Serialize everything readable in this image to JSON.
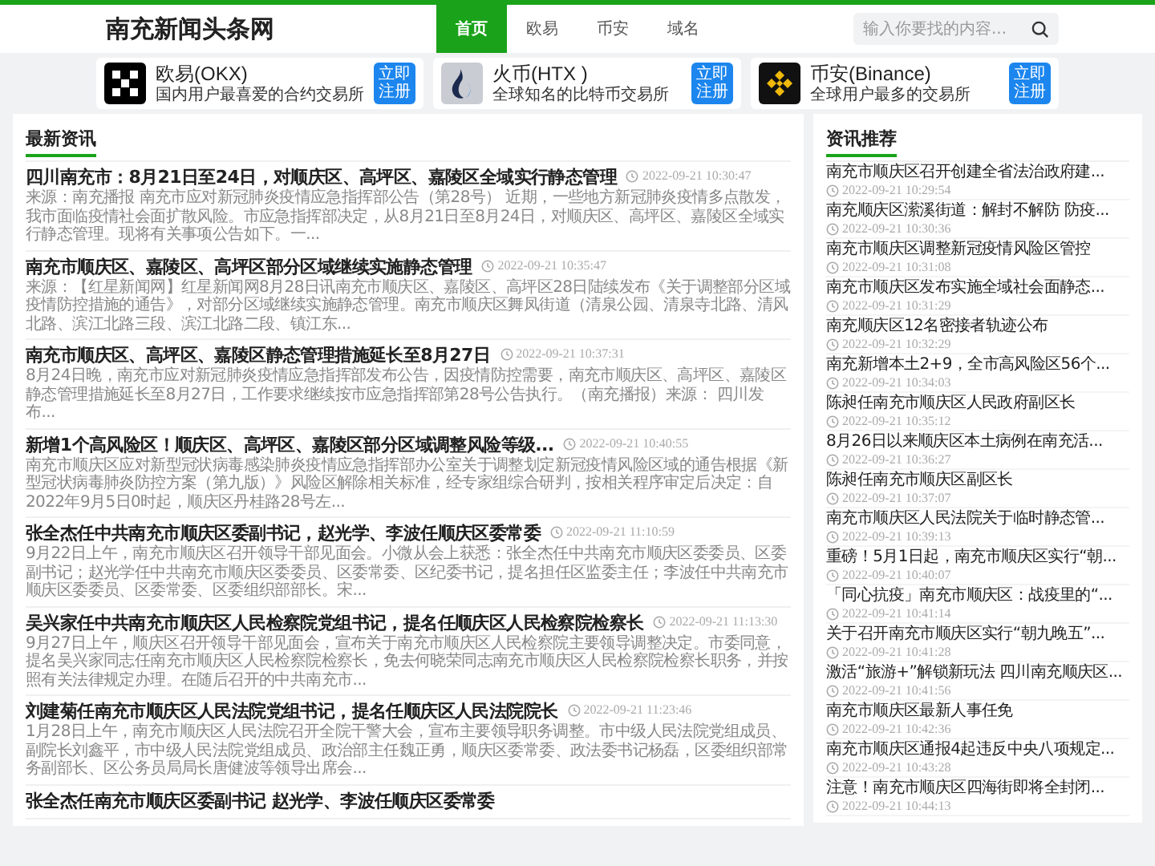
{
  "header": {
    "logo": "南充新闻头条网",
    "nav": [
      {
        "label": "首页",
        "selected": true
      },
      {
        "label": "欧易",
        "selected": false
      },
      {
        "label": "币安",
        "selected": false
      },
      {
        "label": "域名",
        "selected": false
      }
    ],
    "search": {
      "placeholder": "输入你要找的内容..."
    }
  },
  "ads": [
    {
      "title": "欧易(OKX)",
      "subtitle": "国内用户最喜爱的合约交易所",
      "button": "立即注册"
    },
    {
      "title": "火币(HTX )",
      "subtitle": "全球知名的比特币交易所",
      "button": "立即注册"
    },
    {
      "title": "币安(Binance)",
      "subtitle": "全球用户最多的交易所",
      "button": "立即注册"
    }
  ],
  "latest": {
    "heading": "最新资讯",
    "articles": [
      {
        "title": "四川南充市：8月21日至24日，对顺庆区、高坪区、嘉陵区全域实行静态管理",
        "time": "2022-09-21 10:30:47",
        "summary": "来源：南充播报 南充市应对新冠肺炎疫情应急指挥部公告（第28号） 近期，一些地方新冠肺炎疫情多点散发，我市面临疫情社会面扩散风险。市应急指挥部决定，从8月21日至8月24日，对顺庆区、高坪区、嘉陵区全域实行静态管理。现将有关事项公告如下。一..."
      },
      {
        "title": "南充市顺庆区、嘉陵区、高坪区部分区域继续实施静态管理",
        "time": "2022-09-21 10:35:47",
        "summary": "来源：【红星新闻网】红星新闻网8月28日讯南充市顺庆区、嘉陵区、高坪区28日陆续发布《关于调整部分区域疫情防控措施的通告》，对部分区域继续实施静态管理。南充市顺庆区舞凤街道（清泉公园、清泉寺北路、清风北路、滨江北路三段、滨江北路二段、镇江东..."
      },
      {
        "title": "南充市顺庆区、高坪区、嘉陵区静态管理措施延长至8月27日",
        "time": "2022-09-21 10:37:31",
        "summary": "8月24日晚，南充市应对新冠肺炎疫情应急指挥部发布公告，因疫情防控需要，南充市顺庆区、高坪区、嘉陵区静态管理措施延长至8月27日，工作要求继续按市应急指挥部第28号公告执行。（南充播报）来源：  四川发布..."
      },
      {
        "title": "新增1个高风险区！顺庆区、高坪区、嘉陵区部分区域调整风险等级...",
        "time": "2022-09-21 10:40:55",
        "summary": "南充市顺庆区应对新型冠状病毒感染肺炎疫情应急指挥部办公室关于调整划定新冠疫情风险区域的通告根据《新型冠状病毒肺炎防控方案（第九版）》风险区解除相关标准，经专家组综合研判，按相关程序审定后决定：自2022年9月5日0时起，顺庆区丹桂路28号左..."
      },
      {
        "title": "张全杰任中共南充市顺庆区委副书记，赵光学、李波任顺庆区委常委",
        "time": "2022-09-21 11:10:59",
        "summary": "9月22日上午，南充市顺庆区召开领导干部见面会。小微从会上获悉：张全杰任中共南充市顺庆区委委员、区委副书记；赵光学任中共南充市顺庆区委委员、区委常委、区纪委书记，提名担任区监委主任；李波任中共南充市顺庆区委委员、区委常委、区委组织部部长。宋..."
      },
      {
        "title": "吴兴家任中共南充市顺庆区人民检察院党组书记，提名任顺庆区人民检察院检察长",
        "time": "2022-09-21 11:13:30",
        "summary": "9月27日上午，顺庆区召开领导干部见面会，宣布关于南充市顺庆区人民检察院主要领导调整决定。市委同意，提名吴兴家同志任南充市顺庆区人民检察院检察长，免去何晓荣同志南充市顺庆区人民检察院检察长职务，并按照有关法律规定办理。在随后召开的中共南充市..."
      },
      {
        "title": "刘建菊任南充市顺庆区人民法院党组书记，提名任顺庆区人民法院院长",
        "time": "2022-09-21 11:23:46",
        "summary": "1月28日上午，南充市顺庆区人民法院召开全院干警大会，宣布主要领导职务调整。市中级人民法院党组成员、副院长刘鑫平，市中级人民法院党组成员、政治部主任魏正勇，顺庆区委常委、政法委书记杨磊，区委组织部常务副部长、区公务员局局长唐健波等领导出席会..."
      },
      {
        "title": "张全杰任南充市顺庆区委副书记 赵光学、李波任顺庆区委常委"
      }
    ]
  },
  "recommended": {
    "heading": "资讯推荐",
    "items": [
      {
        "title": "南充市顺庆区召开创建全省法治政府建...",
        "time": "2022-09-21 10:29:54"
      },
      {
        "title": "南充顺庆区潆溪街道：解封不解防 防疫...",
        "time": "2022-09-21 10:30:36"
      },
      {
        "title": "南充市顺庆区调整新冠疫情风险区管控",
        "time": "2022-09-21 10:31:08"
      },
      {
        "title": "南充市顺庆区发布实施全域社会面静态...",
        "time": "2022-09-21 10:31:29"
      },
      {
        "title": "南充顺庆区12名密接者轨迹公布",
        "time": "2022-09-21 10:32:29"
      },
      {
        "title": "南充新增本土2+9，全市高风险区56个...",
        "time": "2022-09-21 10:34:03"
      },
      {
        "title": "陈昶任南充市顺庆区人民政府副区长",
        "time": "2022-09-21 10:35:12"
      },
      {
        "title": "8月26日以来顺庆区本土病例在南充活...",
        "time": "2022-09-21 10:36:27"
      },
      {
        "title": "陈昶任南充市顺庆区副区长",
        "time": "2022-09-21 10:37:07"
      },
      {
        "title": "南充市顺庆区人民法院关于临时静态管...",
        "time": "2022-09-21 10:39:13"
      },
      {
        "title": "重磅！5月1日起，南充市顺庆区实行“朝...",
        "time": "2022-09-21 10:40:07"
      },
      {
        "title": "「同心抗疫」南充市顺庆区：战疫里的“...",
        "time": "2022-09-21 10:41:14"
      },
      {
        "title": "关于召开南充市顺庆区实行“朝九晚五”...",
        "time": "2022-09-21 10:41:28"
      },
      {
        "title": "激活“旅游+”解锁新玩法 四川南充顺庆区...",
        "time": "2022-09-21 10:41:56"
      },
      {
        "title": "南充市顺庆区最新人事任免",
        "time": "2022-09-21 10:42:36"
      },
      {
        "title": "南充市顺庆区通报4起违反中央八项规定...",
        "time": "2022-09-21 10:43:28"
      },
      {
        "title": "注意！南充市顺庆区四海街即将全封闭...",
        "time": "2022-09-21 10:44:13"
      }
    ]
  }
}
